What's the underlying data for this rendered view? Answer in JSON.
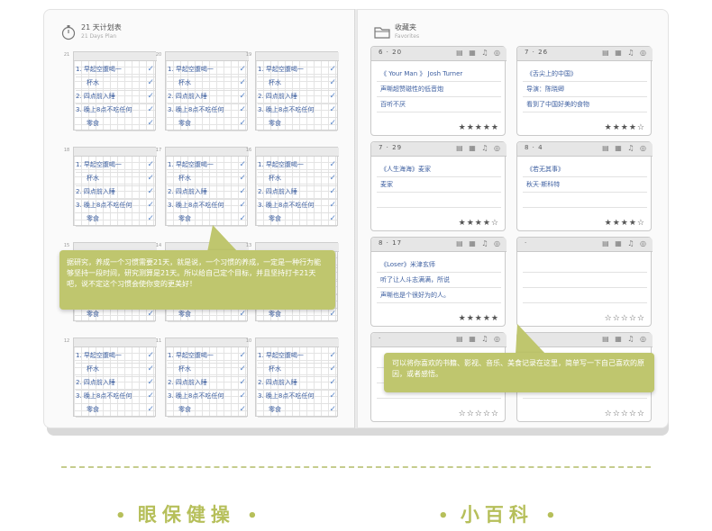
{
  "left_page": {
    "title": "21 天计划表",
    "subtitle": "21 Days Plan",
    "day_labels": [
      [
        "21",
        "20",
        "19"
      ],
      [
        "18",
        "17",
        "16"
      ],
      [
        "15",
        "14",
        "13"
      ],
      [
        "12",
        "11",
        "10"
      ]
    ],
    "habits": [
      "1. 早起空腹喝一",
      "杯水",
      "2. 四点前入睡",
      "3. 晚上8点不吃任何",
      "零食"
    ],
    "tooltip": "据研究，养成一个习惯需要21天，就是说，一个习惯的养成，一定是一种行为能够坚持一段时间，研究测算是21天。所以给自己定个目标，并且坚持打卡21天吧，说不定这个习惯会使你变的更美好！"
  },
  "right_page": {
    "title": "收藏夹",
    "subtitle": "Favorites",
    "cards": [
      {
        "date": "6 · 20",
        "icons": "▤ ▦ ♫ ◎",
        "lines": [
          "《 Your Man 》 Josh Turner",
          "声嘶超赞磁性的低音炮",
          "百听不厌"
        ],
        "stars": "★★★★★"
      },
      {
        "date": "7 · 26",
        "icons": "▤ ▦ ♫ ◎",
        "lines": [
          "《舌尖上的中国》",
          "导演：陈晓卿",
          "看到了中国好美的食物"
        ],
        "stars": "★★★★☆"
      },
      {
        "date": "7 · 29",
        "icons": "▤ ▦ ♫ ◎",
        "lines": [
          "《人生海海》麦家",
          "麦家",
          ""
        ],
        "stars": "★★★★☆"
      },
      {
        "date": "8 · 4",
        "icons": "▤ ▦ ♫ ◎",
        "lines": [
          "《若无其事》",
          "秋天·斯科特",
          ""
        ],
        "stars": "★★★★☆"
      },
      {
        "date": "8 · 17",
        "icons": "▤ ▦ ♫ ◎",
        "lines": [
          "《Loser》米津玄师",
          "听了让人斗志满满，所说",
          "声嘶也是个很好为的人。"
        ],
        "stars": "★★★★★"
      },
      {
        "date": "·",
        "icons": "▤ ▦ ♫ ◎",
        "lines": [
          "",
          "",
          ""
        ],
        "stars": "☆☆☆☆☆"
      },
      {
        "date": "·",
        "icons": "▤ ▦ ♫ ◎",
        "lines": [
          "",
          "",
          ""
        ],
        "stars": "☆☆☆☆☆"
      },
      {
        "date": "·",
        "icons": "▤ ▦ ♫ ◎",
        "lines": [
          "",
          "",
          ""
        ],
        "stars": "☆☆☆☆☆"
      }
    ],
    "tooltip": "可以将你喜欢的书籍、影视、音乐、美食记录在这里，简单写一下自己喜欢的原因，或者感悟。"
  },
  "footer": {
    "left_label": "眼保健操",
    "right_label": "小百科",
    "dot": "•"
  },
  "colors": {
    "accent": "#bfc66e",
    "footer_text": "#b6bf5a",
    "handwriting": "#3d5fa0"
  }
}
